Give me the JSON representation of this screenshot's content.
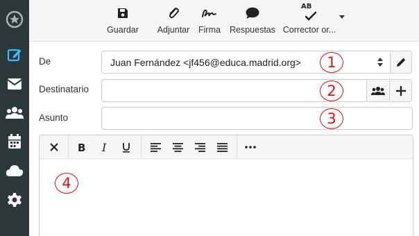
{
  "sidebar": {
    "items": [
      {
        "icon": "logo-icon"
      },
      {
        "icon": "compose-icon",
        "active": true
      },
      {
        "icon": "mail-icon"
      },
      {
        "icon": "contacts-icon"
      },
      {
        "icon": "calendar-icon"
      },
      {
        "icon": "cloud-icon"
      },
      {
        "icon": "settings-icon"
      }
    ]
  },
  "toolbar": {
    "save_label": "Guardar",
    "attach_label": "Adjuntar",
    "signature_label": "Firma",
    "responses_label": "Respuestas",
    "spell_label": "Corrector or...",
    "spell_icon_text": "AB"
  },
  "form": {
    "from_label": "De",
    "from_value": "Juan Fernández <jf456@educa.madrid.org>",
    "to_label": "Destinatario",
    "to_value": "",
    "subject_label": "Asunto",
    "subject_value": ""
  },
  "annotations": [
    "1",
    "2",
    "3",
    "4"
  ],
  "colors": {
    "sidebar_bg": "#2c373a",
    "accent": "#37beff",
    "annotation": "#dd1111"
  }
}
